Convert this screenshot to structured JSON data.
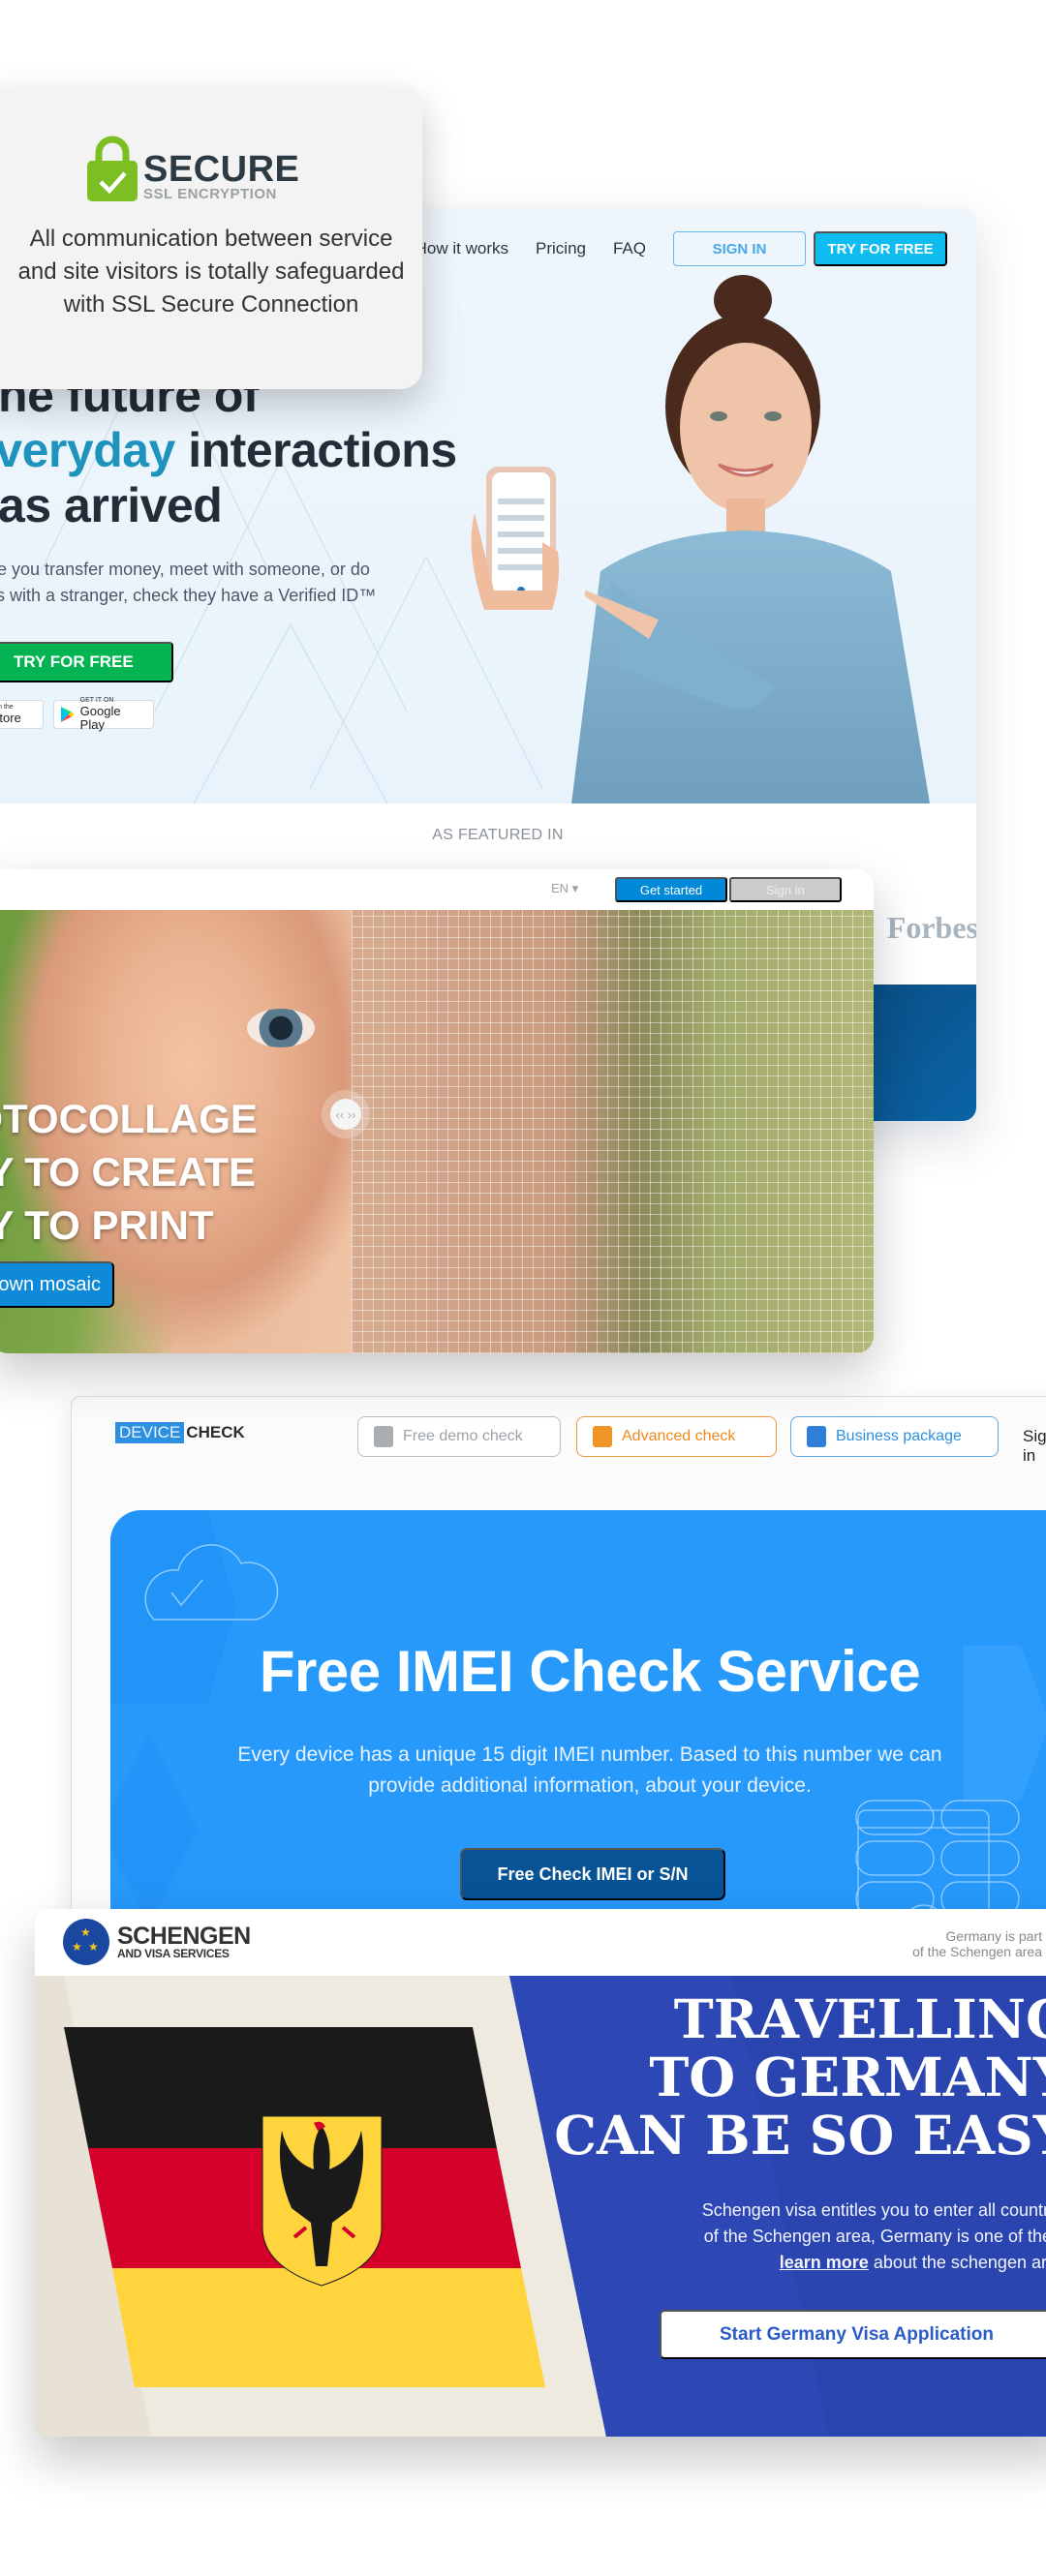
{
  "ssl_badge": {
    "title": "SECURE",
    "subtitle": "SSL ENCRYPTION",
    "description": "All communication between service and site visitors is totally safeguarded with SSL Secure Connection",
    "colors": {
      "lock": "#7cbf22",
      "title": "#2c3a44"
    }
  },
  "verified_id_site": {
    "nav": {
      "links": [
        "How it works",
        "Pricing",
        "FAQ"
      ],
      "sign_in": "SIGN IN",
      "try_free": "TRY FOR FREE"
    },
    "headline": {
      "line1": "The future of",
      "line2_accent": "everyday",
      "line2_rest": " interactions",
      "line3": "has arrived"
    },
    "subtitle_line1": "Before you transfer money, meet with someone, or do",
    "subtitle_line2": "business with a stranger, check they have a Verified ID™",
    "cta": "TRY FOR FREE",
    "app_store": {
      "small": "Available on the",
      "big": "App Store"
    },
    "google_play": {
      "small": "GET IT ON",
      "big": "Google Play"
    },
    "featured_label": "AS FEATURED IN",
    "featured_logo": "Forbes",
    "colors": {
      "accent": "#1d93bd",
      "cta": "#04b453",
      "nav_button": "#0ebcf0"
    }
  },
  "photocollage_site": {
    "language": "EN ▾",
    "get_started": "Get started",
    "sign_in": "Sign in",
    "headline": [
      "PHOTOCOLLAGE",
      "EASY TO CREATE",
      "EASY TO PRINT"
    ],
    "cta": "Create your own mosaic",
    "slider_icon": "‹‹ ››"
  },
  "device_check_site": {
    "logo_part1": "DEVICE",
    "logo_part2": "CHECK",
    "tabs": [
      {
        "label": "Free demo check",
        "color": "#9ea3a8"
      },
      {
        "label": "Advanced check",
        "color": "#ee8a1e"
      },
      {
        "label": "Business package",
        "color": "#2d8fe0"
      }
    ],
    "sign_in_partial": "Sign in",
    "title": "Free IMEI Check Service",
    "description": "Every device has a unique 15 digit IMEI number. Based to this number we can provide additional information, about your device.",
    "cta": "Free Check IMEI or S/N"
  },
  "schengen_site": {
    "logo_title": "SCHENGEN",
    "logo_subtitle": "AND VISA SERVICES",
    "header_note_line1": "Germany is part",
    "header_note_line2": "of the Schengen area",
    "headline": [
      "TRAVELLING",
      "TO GERMANY",
      "CAN BE SO EASY"
    ],
    "text_line1": "Schengen visa entitles you to enter all countries",
    "text_line2": "of the Schengen area, Germany is one of them.",
    "learn_more": "learn more",
    "text_line3_rest": " about the schengen area.",
    "cta": "Start Germany Visa Application",
    "flag_colors": [
      "#1a1a1a",
      "#d4002a",
      "#ffd43c"
    ]
  }
}
